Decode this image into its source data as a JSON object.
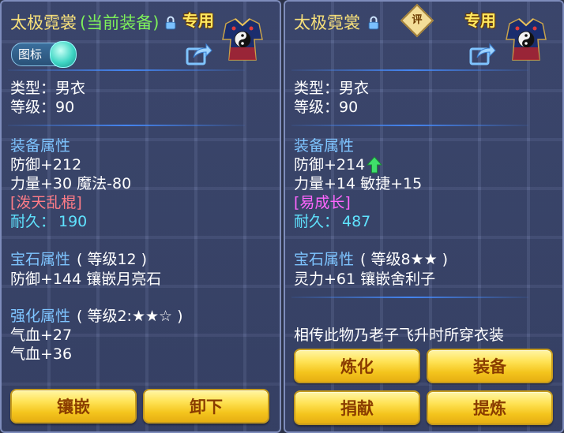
{
  "colors": {
    "panel_bg": "#48557f",
    "section": "#7ec4ff",
    "gold_title": "#f7e07a",
    "equipped": "#7df05a",
    "durability": "#5fe3ff",
    "red_skill": "#ff7c87",
    "pink_skill": "#ff66ff",
    "button_gold": "#f4c51d",
    "button_text": "#8a3d00"
  },
  "left": {
    "title": "太极霓裳",
    "equipped_note": "(当前装备)",
    "exclusive": "专用",
    "toggle_label": "图标",
    "type": "类型：男衣",
    "level": "等级：90",
    "equip_header": "装备属性",
    "stat1": "防御+212",
    "stat2": "力量+30 魔法-80",
    "special": "[泼天乱棍]",
    "durability_label": "耐久：",
    "durability_value": "190",
    "gem_header": "宝石属性",
    "gem_level": "( 等级12 )",
    "gem_effect": "防御+144 镶嵌月亮石",
    "refine_header": "强化属性",
    "refine_level": "( 等级2:★★☆ )",
    "refine1": "气血+27",
    "refine2": "气血+36",
    "buttons": [
      "镶嵌",
      "卸下"
    ]
  },
  "right": {
    "title": "太极霓裳",
    "rate_badge": "评",
    "exclusive": "专用",
    "type": "类型：男衣",
    "level": "等级：90",
    "equip_header": "装备属性",
    "stat1": "防御+214",
    "stat2": "力量+14 敏捷+15",
    "special": "[易成长]",
    "durability_label": "耐久：",
    "durability_value": "487",
    "gem_header": "宝石属性",
    "gem_level": "( 等级8★★ )",
    "gem_effect": "灵力+61 镶嵌舍利子",
    "description": "相传此物乃老子飞升时所穿衣装",
    "buttons": [
      "炼化",
      "装备",
      "捐献",
      "提炼"
    ]
  }
}
